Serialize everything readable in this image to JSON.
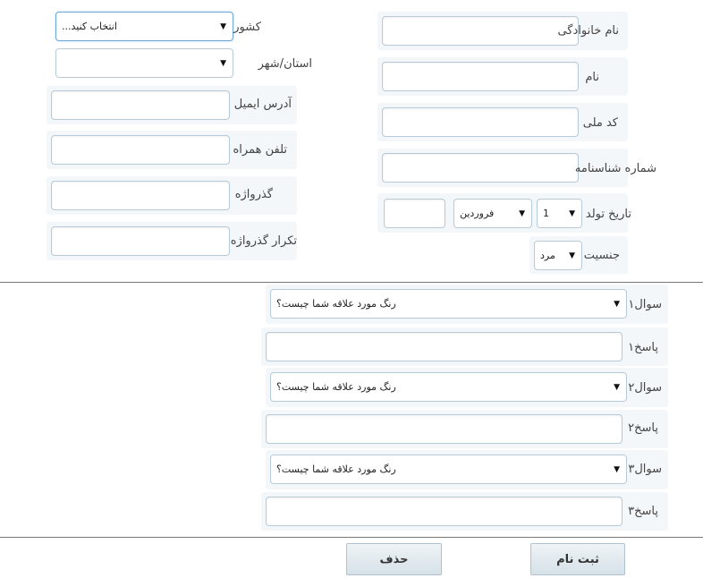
{
  "personal": {
    "last_name_label": "نام خانوادگی",
    "first_name_label": "نام",
    "national_code_label": "کد ملی",
    "id_number_label": "شماره شناسنامه",
    "birth_date_label": "تاریخ تولد",
    "birth_day_value": "1",
    "birth_month_value": "فروردین",
    "gender_label": "جنسیت",
    "gender_value": "مرد"
  },
  "contact": {
    "country_label": "کشور",
    "country_value": "انتخاب کنید...",
    "province_label": "استان/شهر",
    "province_value": "",
    "email_label": "آدرس ایمیل",
    "mobile_label": "تلفن همراه",
    "password_label": "گذرواژه",
    "password_repeat_label": "تکرار گذرواژه"
  },
  "security": {
    "questions": [
      {
        "label": "سوال۱",
        "value": "رنگ مورد علاقه شما چیست؟",
        "answer_label": "پاسخ۱"
      },
      {
        "label": "سوال۲",
        "value": "رنگ مورد علاقه شما چیست؟",
        "answer_label": "پاسخ۲"
      },
      {
        "label": "سوال۳",
        "value": "رنگ مورد علاقه شما چیست؟",
        "answer_label": "پاسخ۳"
      }
    ]
  },
  "actions": {
    "register_label": "ثبت نام",
    "delete_label": "حذف"
  }
}
